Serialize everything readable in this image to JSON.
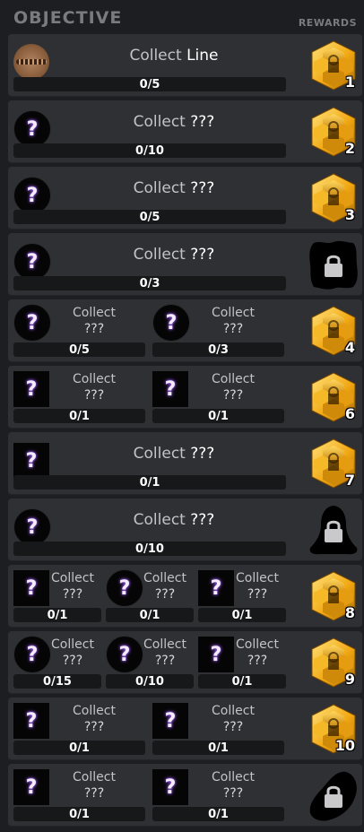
{
  "header": {
    "title": "OBJECTIVE",
    "rewards_label": "REWARDS"
  },
  "rows": [
    {
      "type": "single",
      "icon": "line-thumbnail",
      "label": "Collect",
      "value": "Line",
      "progress": "0/5",
      "reward": {
        "kind": "gold",
        "number": "1"
      }
    },
    {
      "type": "single",
      "icon": "circle",
      "label": "Collect",
      "value": "???",
      "progress": "0/10",
      "reward": {
        "kind": "gold",
        "number": "2"
      }
    },
    {
      "type": "single",
      "icon": "circle",
      "label": "Collect",
      "value": "???",
      "progress": "0/5",
      "reward": {
        "kind": "gold",
        "number": "3"
      }
    },
    {
      "type": "single",
      "icon": "circle",
      "label": "Collect",
      "value": "???",
      "progress": "0/3",
      "reward": {
        "kind": "locked",
        "shape": "blob",
        "number": ""
      }
    },
    {
      "type": "multi",
      "items": [
        {
          "icon": "circle",
          "label": "Collect",
          "value": "???",
          "progress": "0/5"
        },
        {
          "icon": "circle",
          "label": "Collect",
          "value": "???",
          "progress": "0/3"
        }
      ],
      "reward": {
        "kind": "gold",
        "number": "4"
      }
    },
    {
      "type": "multi",
      "items": [
        {
          "icon": "square",
          "label": "Collect",
          "value": "???",
          "progress": "0/1"
        },
        {
          "icon": "square",
          "label": "Collect",
          "value": "???",
          "progress": "0/1"
        }
      ],
      "reward": {
        "kind": "gold",
        "number": "6"
      }
    },
    {
      "type": "single",
      "icon": "square",
      "label": "Collect",
      "value": "???",
      "progress": "0/1",
      "reward": {
        "kind": "gold",
        "number": "7"
      }
    },
    {
      "type": "single",
      "icon": "circle",
      "label": "Collect",
      "value": "???",
      "progress": "0/10",
      "reward": {
        "kind": "locked",
        "shape": "bell",
        "number": ""
      }
    },
    {
      "type": "multi",
      "items": [
        {
          "icon": "square",
          "label": "Collect",
          "value": "???",
          "progress": "0/1"
        },
        {
          "icon": "circle",
          "label": "Collect",
          "value": "???",
          "progress": "0/1"
        },
        {
          "icon": "square",
          "label": "Collect",
          "value": "???",
          "progress": "0/1"
        }
      ],
      "reward": {
        "kind": "gold",
        "number": "8"
      }
    },
    {
      "type": "multi",
      "items": [
        {
          "icon": "circle",
          "label": "Collect",
          "value": "???",
          "progress": "0/15"
        },
        {
          "icon": "circle",
          "label": "Collect",
          "value": "???",
          "progress": "0/10"
        },
        {
          "icon": "square",
          "label": "Collect",
          "value": "???",
          "progress": "0/1"
        }
      ],
      "reward": {
        "kind": "gold",
        "number": "9"
      }
    },
    {
      "type": "multi",
      "items": [
        {
          "icon": "square",
          "label": "Collect",
          "value": "???",
          "progress": "0/1"
        },
        {
          "icon": "square",
          "label": "Collect",
          "value": "???",
          "progress": "0/1"
        }
      ],
      "reward": {
        "kind": "gold",
        "number": "10"
      }
    },
    {
      "type": "multi",
      "items": [
        {
          "icon": "square",
          "label": "Collect",
          "value": "???",
          "progress": "0/1"
        },
        {
          "icon": "square",
          "label": "Collect",
          "value": "???",
          "progress": "0/1"
        }
      ],
      "reward": {
        "kind": "locked",
        "shape": "leaf",
        "number": ""
      }
    }
  ],
  "colors": {
    "row_bg": "#2f3034",
    "bar_bg": "#17181a",
    "gold": "#f3b21b",
    "question_glow": "#b06bff"
  }
}
